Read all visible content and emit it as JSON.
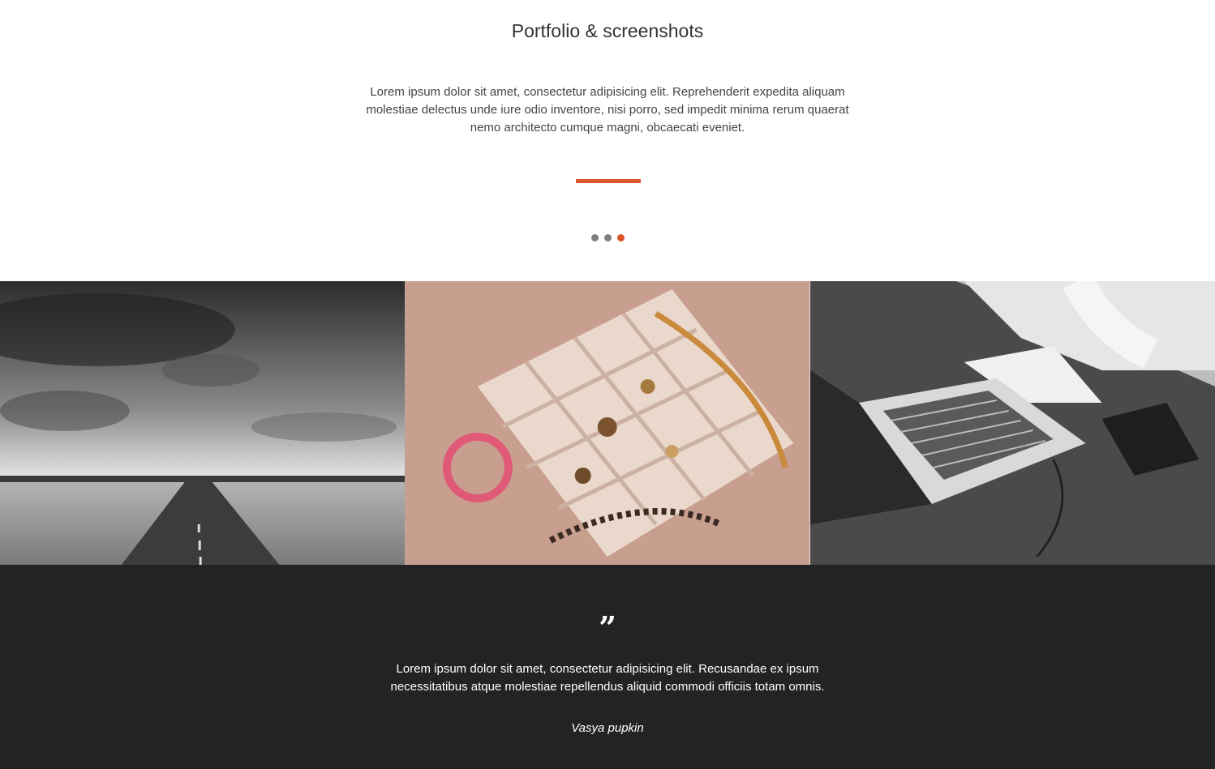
{
  "intro": {
    "title": "Portfolio & screenshots",
    "text": "Lorem ipsum dolor sit amet, consectetur adipisicing elit. Reprehenderit expedita aliquam molestiae delectus unde iure odio inventore, nisi porro, sed impedit minima rerum quaerat nemo architecto cumque magni, obcaecati eveniet.",
    "accent_color": "#d9562b",
    "slider": {
      "dot_count": 3,
      "active_index": 2
    }
  },
  "gallery": {
    "items": [
      {
        "subject": "road-landscape",
        "tone": "grayscale"
      },
      {
        "subject": "jewelry-box",
        "tone": "warm"
      },
      {
        "subject": "laptop-workspace",
        "tone": "grayscale"
      }
    ]
  },
  "testimonial": {
    "icon": "quote-icon",
    "text": "Lorem ipsum dolor sit amet, consectetur adipisicing elit. Recusandae ex ipsum necessitatibus atque molestiae repellendus aliquid commodi officiis totam omnis.",
    "author": "Vasya pupkin",
    "background": "#232323"
  }
}
